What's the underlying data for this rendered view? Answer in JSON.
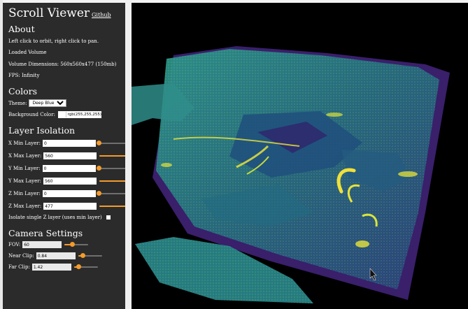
{
  "app": {
    "title": "Scroll Viewer",
    "github_link": "Github"
  },
  "about": {
    "heading": "About",
    "instructions": "Left click to orbit, right click to pan.",
    "status": "Loaded Volume",
    "dimensions": "Volume Dimensions: 560x560x477 (150mb)",
    "fps": "FPS: Infinity"
  },
  "colors": {
    "heading": "Colors",
    "theme_label": "Theme:",
    "theme_value": "Deep Blue",
    "background_label": "Background Color:",
    "background_value": "rgb(255,255,255)"
  },
  "layers": {
    "heading": "Layer Isolation",
    "items": [
      {
        "label": "X Min Layer:",
        "value": "0",
        "fraction": 0.0
      },
      {
        "label": "X Max Layer:",
        "value": "560",
        "fraction": 1.0
      },
      {
        "label": "Y Min Layer:",
        "value": "0",
        "fraction": 0.0
      },
      {
        "label": "Y Max Layer:",
        "value": "560",
        "fraction": 1.0
      },
      {
        "label": "Z Min Layer:",
        "value": "0",
        "fraction": 0.0
      },
      {
        "label": "Z Max Layer:",
        "value": "477",
        "fraction": 1.0
      }
    ],
    "isolate_label": "Isolate single Z layer (uses min layer)"
  },
  "camera": {
    "heading": "Camera Settings",
    "items": [
      {
        "label": "FOV:",
        "value": "60",
        "fraction": 0.33
      },
      {
        "label": "Near Clip:",
        "value": "0.84",
        "fraction": 0.18
      },
      {
        "label": "Far Clip:",
        "value": "1.42",
        "fraction": 0.18
      }
    ]
  },
  "colors_palette": {
    "accent": "#f59b2a",
    "panel": "#2b2b2b",
    "volume_dark": "#3b1f6e",
    "volume_mid": "#2a8a8e",
    "volume_light": "#7fd15a",
    "volume_hot": "#e8e33a"
  }
}
